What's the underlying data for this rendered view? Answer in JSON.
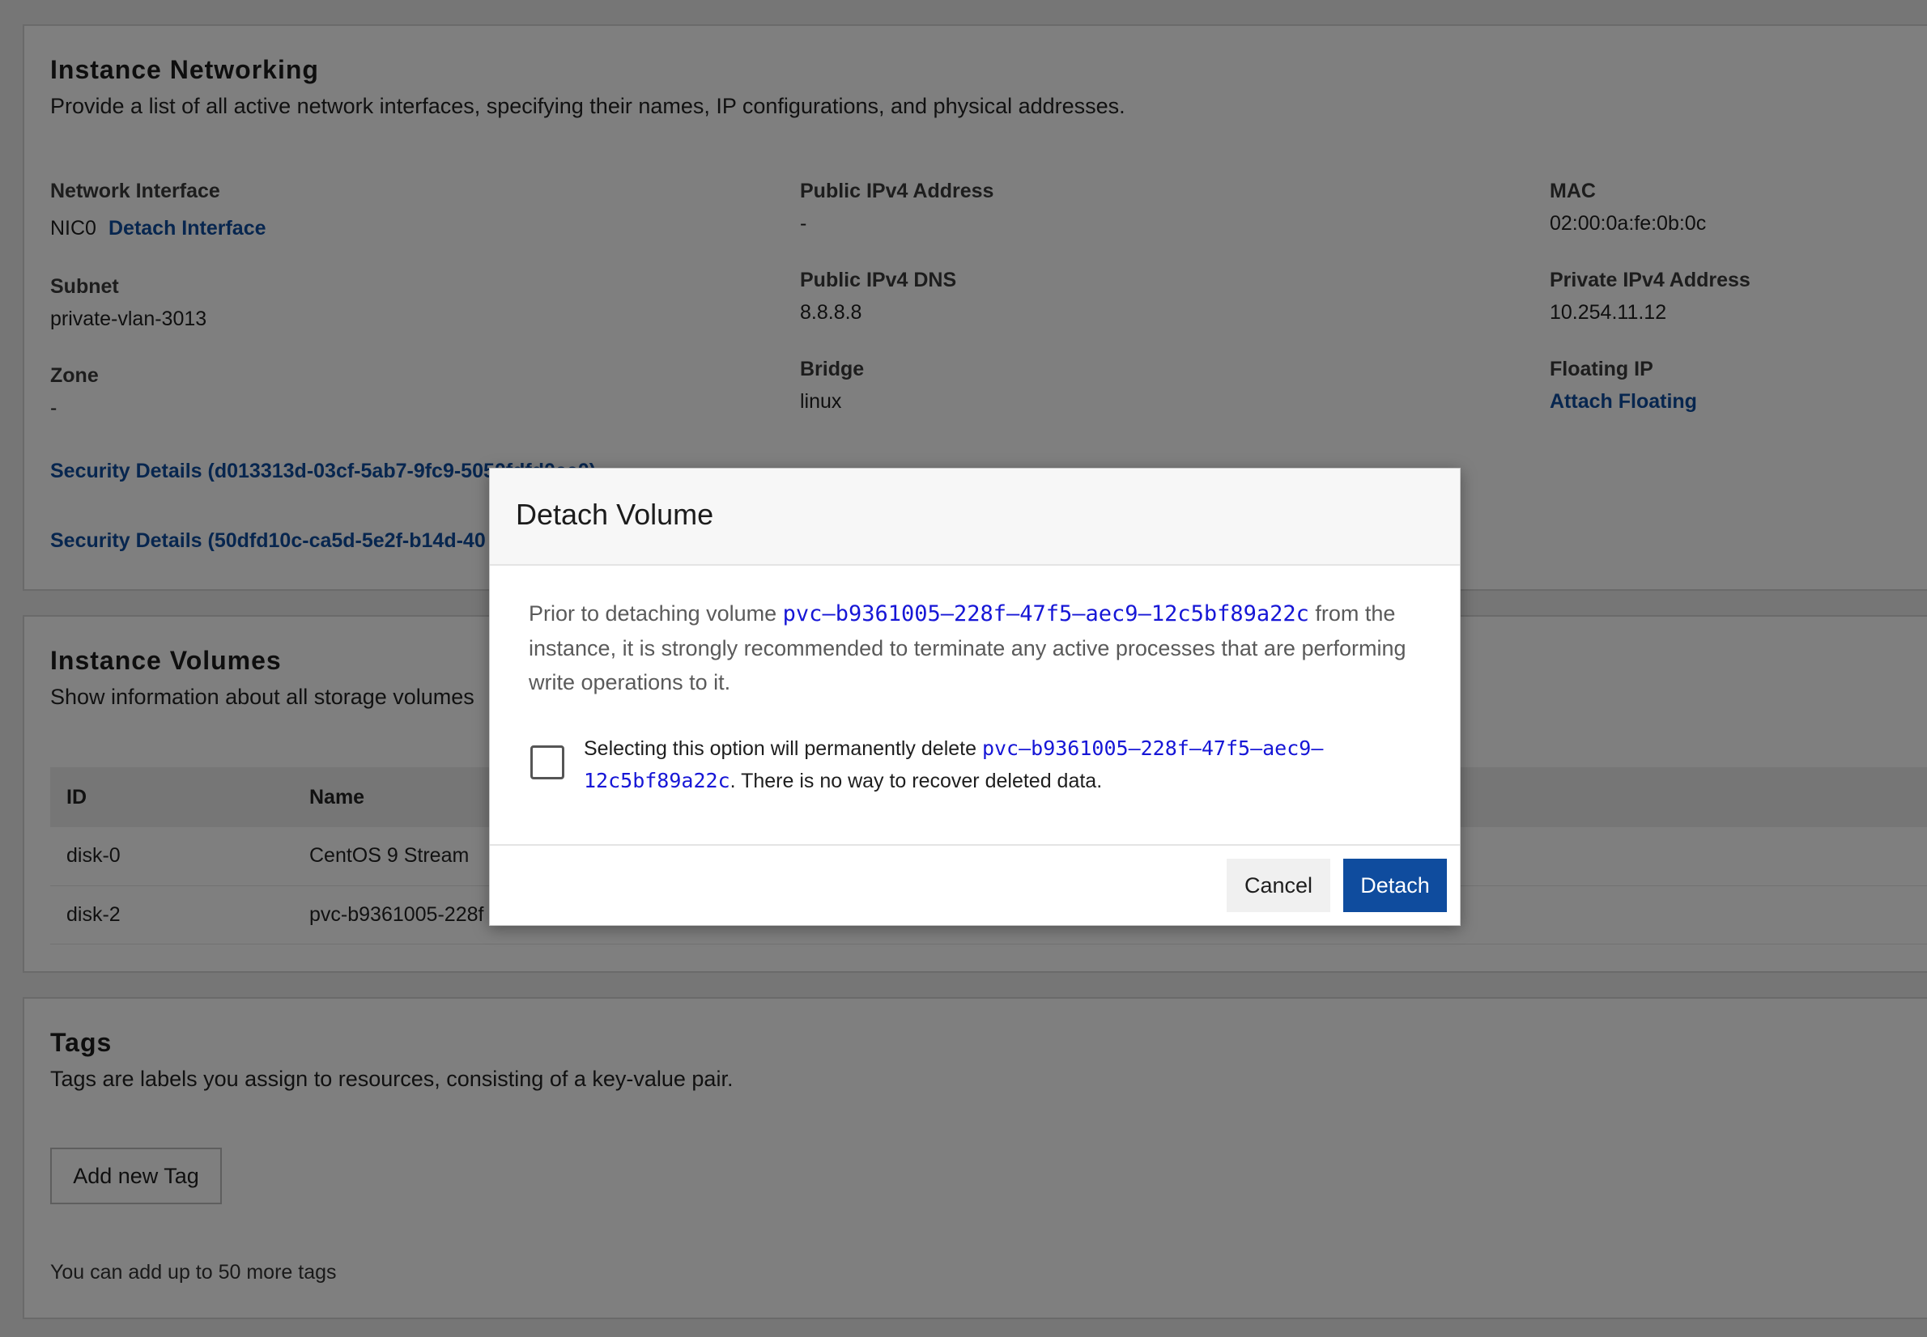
{
  "networking": {
    "title": "Instance Networking",
    "description": "Provide a list of all active network interfaces, specifying their names, IP configurations, and physical addresses.",
    "network_interface_label": "Network Interface",
    "network_interface_value": "NIC0",
    "detach_interface_link": "Detach Interface",
    "subnet_label": "Subnet",
    "subnet_value": "private-vlan-3013",
    "zone_label": "Zone",
    "zone_value": "-",
    "public_ipv4_label": "Public IPv4 Address",
    "public_ipv4_value": "-",
    "public_dns_label": "Public IPv4 DNS",
    "public_dns_value": "8.8.8.8",
    "bridge_label": "Bridge",
    "bridge_value": "linux",
    "mac_label": "MAC",
    "mac_value": "02:00:0a:fe:0b:0c",
    "private_ipv4_label": "Private IPv4 Address",
    "private_ipv4_value": "10.254.11.12",
    "floating_ip_label": "Floating IP",
    "attach_floating_link": "Attach Floating",
    "security_links": [
      "Security Details (d013313d-03cf-5ab7-9fc9-5050fdfd0ee0)",
      "Security Details (50dfd10c-ca5d-5e2f-b14d-40"
    ]
  },
  "volumes": {
    "title": "Instance Volumes",
    "description": "Show information about all storage volumes",
    "columns": [
      "ID",
      "Name"
    ],
    "rows": [
      [
        "disk-0",
        "CentOS 9 Stream"
      ],
      [
        "disk-2",
        "pvc-b9361005-228f"
      ]
    ]
  },
  "tags": {
    "title": "Tags",
    "description": "Tags are labels you assign to resources, consisting of a key-value pair.",
    "add_button": "Add new Tag",
    "limit_note": "You can add up to 50 more tags"
  },
  "modal": {
    "title": "Detach Volume",
    "body_prefix": "Prior to detaching volume ",
    "volume_id": "pvc–b9361005–228f–47f5–aec9–12c5bf89a22c",
    "body_suffix": " from the instance, it is strongly recommended to terminate any active processes that are performing write operations to it.",
    "checkbox_prefix": "Selecting this option will permanently delete ",
    "checkbox_volume_id": "pvc–b9361005–228f–47f5–aec9–12c5bf89a22c",
    "checkbox_suffix": ". There is no way to recover deleted data.",
    "cancel_label": "Cancel",
    "detach_label": "Detach"
  },
  "colors": {
    "primary": "#0f4c9e",
    "mono_link": "#1616d6",
    "overlay": "rgba(0,0,0,0.5)"
  }
}
